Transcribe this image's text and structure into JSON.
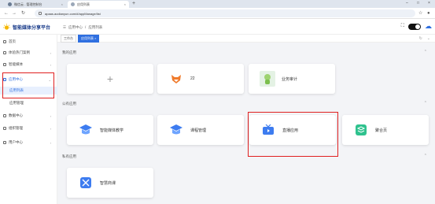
{
  "browser": {
    "tabs": [
      {
        "title": "微信云 - 管理控制台"
      },
      {
        "title": "应用列表"
      }
    ],
    "new_tab": "+",
    "url": "apaas.aodianyun.com/#/appManage/list"
  },
  "header": {
    "brand": "智能媒体分享平台",
    "breadcrumb": [
      "应用中心",
      "/",
      "应用列表"
    ]
  },
  "tags": [
    {
      "label": "工作台",
      "active": false
    },
    {
      "label": "应用列表 ×",
      "active": true
    }
  ],
  "sidebar": {
    "items": [
      {
        "label": "首页"
      },
      {
        "label": "体验热门案例",
        "chev": "›"
      },
      {
        "label": "智能媒体",
        "chev": "›"
      },
      {
        "label": "应用中心",
        "chev": "⌄"
      },
      {
        "label": "应用列表"
      },
      {
        "label": "应用管理"
      },
      {
        "label": "数据中心",
        "chev": "›"
      },
      {
        "label": "组织管理",
        "chev": "›"
      },
      {
        "label": "用户中心",
        "chev": "›"
      }
    ]
  },
  "sections": {
    "my_apps": {
      "title": "我的应用",
      "cards": [
        {
          "label": "+"
        },
        {
          "label": "22"
        },
        {
          "label": "业务审计"
        }
      ]
    },
    "public_apps": {
      "title": "公有应用",
      "cards": [
        {
          "label": "智能媒体教学"
        },
        {
          "label": "课程管理"
        },
        {
          "label": "直播应用"
        },
        {
          "label": "聚合页"
        }
      ]
    },
    "private_apps": {
      "title": "私有应用",
      "cards": [
        {
          "label": "智慧商课"
        }
      ]
    }
  },
  "colors": {
    "accent": "#2f6fe0",
    "highlight_box": "#e02020"
  }
}
